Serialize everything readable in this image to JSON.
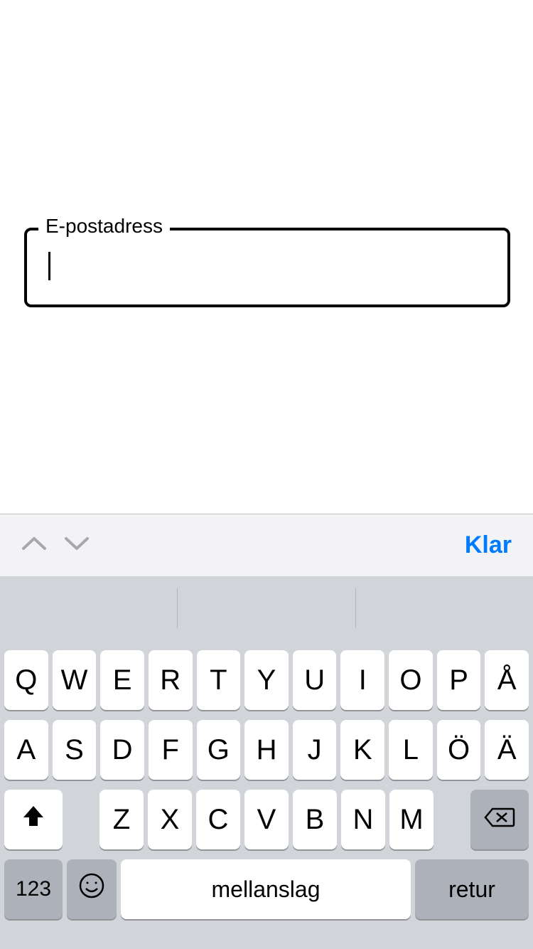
{
  "form": {
    "email_label": "E-postadress",
    "email_value": ""
  },
  "keyboard": {
    "accessory": {
      "done": "Klar"
    },
    "row1": [
      "Q",
      "W",
      "E",
      "R",
      "T",
      "Y",
      "U",
      "I",
      "O",
      "P",
      "Å"
    ],
    "row2": [
      "A",
      "S",
      "D",
      "F",
      "G",
      "H",
      "J",
      "K",
      "L",
      "Ö",
      "Ä"
    ],
    "row3": [
      "Z",
      "X",
      "C",
      "V",
      "B",
      "N",
      "M"
    ],
    "numbers_key": "123",
    "space_key": "mellanslag",
    "return_key": "retur"
  }
}
